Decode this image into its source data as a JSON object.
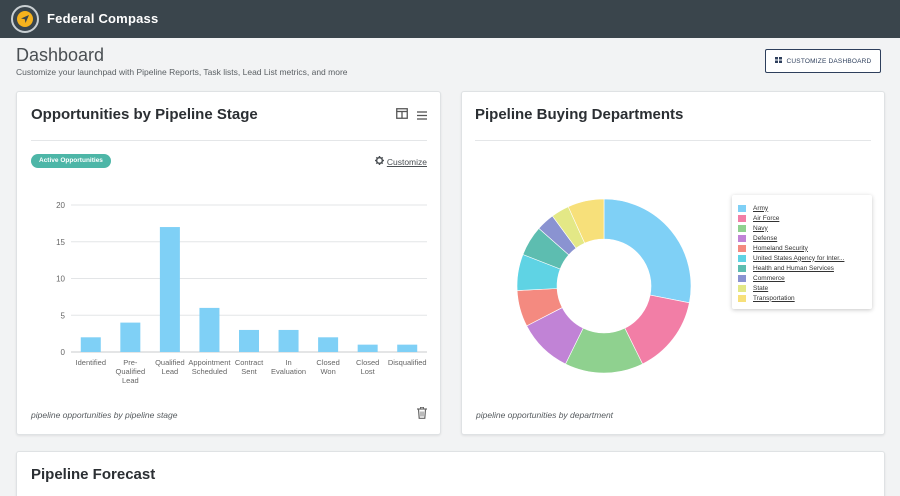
{
  "app": {
    "title": "Federal Compass"
  },
  "page": {
    "title": "Dashboard",
    "subtitle": "Customize your launchpad with Pipeline Reports, Task lists, Lead List metrics, and more",
    "customize_button": "CUSTOMIZE DASHBOARD"
  },
  "card1": {
    "title": "Opportunities by Pipeline Stage",
    "badge": "Active Opportunities",
    "customize_link": "Customize",
    "footnote": "pipeline opportunities by pipeline stage"
  },
  "card2": {
    "title": "Pipeline Buying Departments",
    "footnote": "pipeline opportunities by department"
  },
  "card3": {
    "title": "Pipeline Forecast"
  },
  "chart_data": [
    {
      "type": "bar",
      "categories": [
        [
          "Identified"
        ],
        [
          "Pre-",
          "Qualified",
          "Lead"
        ],
        [
          "Qualified",
          "Lead"
        ],
        [
          "Appointment",
          "Scheduled"
        ],
        [
          "Contract",
          "Sent"
        ],
        [
          "In",
          "Evaluation"
        ],
        [
          "Closed",
          "Won"
        ],
        [
          "Closed",
          "Lost"
        ],
        [
          "Disqualified"
        ]
      ],
      "values": [
        2,
        4,
        17,
        6,
        3,
        3,
        2,
        1,
        1
      ],
      "ylim": [
        0,
        20
      ],
      "yticks": [
        "0",
        "5",
        "10",
        "15",
        "20"
      ],
      "color": "#7fd0f6",
      "grid": true
    },
    {
      "type": "pie",
      "donut": true,
      "labels": [
        "Army",
        "Air Force",
        "Navy",
        "Defense",
        "Homeland Security",
        "United States Agency for Inter...",
        "Health and Human Services",
        "Commerce",
        "State",
        "Transportation"
      ],
      "values": [
        25,
        13,
        13,
        9,
        6,
        6,
        5,
        3,
        3,
        6
      ],
      "colors": [
        "#7fd0f6",
        "#f27ea6",
        "#8fd18f",
        "#c183d6",
        "#f48a80",
        "#5fd3e4",
        "#5dbdb0",
        "#8a93d1",
        "#e3e886",
        "#f7e07a"
      ],
      "legend_position": "right"
    }
  ]
}
